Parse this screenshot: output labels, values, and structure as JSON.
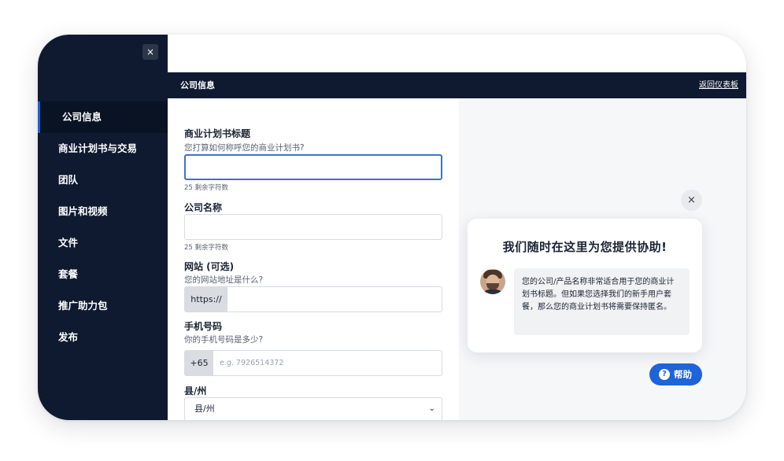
{
  "sidebar": {
    "close_icon": "×",
    "items": [
      {
        "label": "公司信息",
        "active": true
      },
      {
        "label": "商业计划书与交易"
      },
      {
        "label": "团队"
      },
      {
        "label": "图片和视频"
      },
      {
        "label": "文件"
      },
      {
        "label": "套餐"
      },
      {
        "label": "推广助力包"
      },
      {
        "label": "发布"
      }
    ]
  },
  "header": {
    "title": "公司信息",
    "back_link": "返回仪表板"
  },
  "form": {
    "plan_title": {
      "label": "商业计划书标题",
      "hint": "您打算如何称呼您的商业计划书?",
      "value": "",
      "counter": "25 剩余字符数"
    },
    "company_name": {
      "label": "公司名称",
      "value": "",
      "counter": "25 剩余字符数"
    },
    "website": {
      "label": "网站 (可选)",
      "hint": "您的网站地址是什么?",
      "prefix": "https://",
      "value": ""
    },
    "phone": {
      "label": "手机号码",
      "hint": "你的手机号码是多少?",
      "prefix": "+65",
      "placeholder": "e.g. 7926514372",
      "value": ""
    },
    "state": {
      "label": "县/州",
      "selected": "县/州",
      "chevron": "⌄"
    }
  },
  "help": {
    "close_icon": "×",
    "title": "我们随时在这里为您提供协助!",
    "message": "您的公司/产品名称非常适合用于您的商业计划书标题。但如果您选择我们的新手用户套餐，那么您的商业计划书将需要保持匿名。",
    "button_icon": "?",
    "button_label": "帮助"
  },
  "colors": {
    "sidebar_bg": "#0f1a30",
    "accent": "#1d63d9",
    "focus_border": "#3f72c6"
  }
}
